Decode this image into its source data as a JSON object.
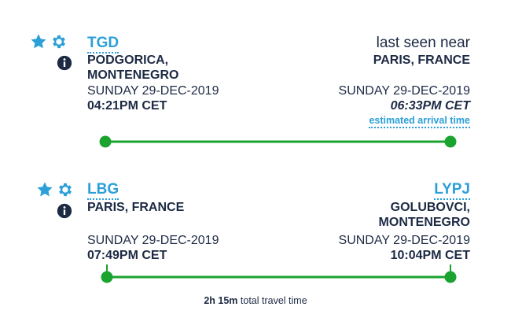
{
  "colors": {
    "accent": "#2a9fd8",
    "text": "#1d2a44",
    "track_green": "#1aa32f"
  },
  "icons": [
    "star-icon",
    "gear-icon",
    "info-icon"
  ],
  "leg1": {
    "origin": {
      "code": "TGD",
      "place_line1": "PODGORICA,",
      "place_line2": "MONTENEGRO",
      "date": "SUNDAY 29-DEC-2019",
      "time": "04:21PM CET"
    },
    "destination": {
      "status": "last seen near",
      "place": "PARIS, FRANCE",
      "date": "SUNDAY 29-DEC-2019",
      "time": "06:33PM CET",
      "eta_label": "estimated arrival time"
    }
  },
  "leg2": {
    "origin": {
      "code": "LBG",
      "place": "PARIS, FRANCE",
      "date": "SUNDAY 29-DEC-2019",
      "time": "07:49PM CET"
    },
    "destination": {
      "code": "LYPJ",
      "place_line1": "GOLUBOVCI,",
      "place_line2": "MONTENEGRO",
      "date": "SUNDAY 29-DEC-2019",
      "time": "10:04PM CET"
    }
  },
  "footer": {
    "duration": "2h 15m",
    "label": "total travel time"
  }
}
